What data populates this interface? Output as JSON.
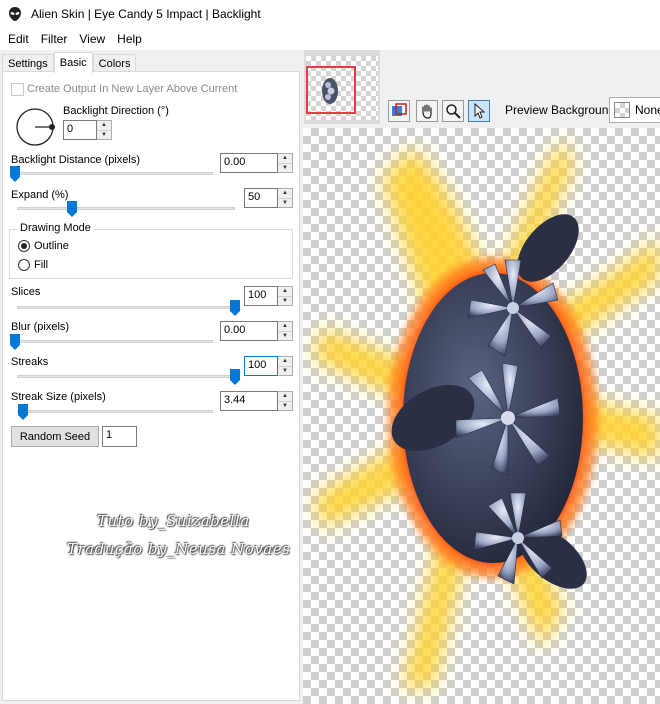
{
  "window": {
    "title": "Alien Skin | Eye Candy 5 Impact | Backlight"
  },
  "menu": [
    "Edit",
    "Filter",
    "View",
    "Help"
  ],
  "tabs": [
    {
      "label": "Settings",
      "active": false
    },
    {
      "label": "Basic",
      "active": true
    },
    {
      "label": "Colors",
      "active": false
    }
  ],
  "settings": {
    "create_output_label": "Create Output In New Layer Above Current",
    "create_output_checked": false,
    "direction_label": "Backlight Direction (°)",
    "direction_value": "0",
    "distance_label": "Backlight Distance (pixels)",
    "distance_value": "0.00",
    "distance_level": 0.0,
    "expand_label": "Expand (%)",
    "expand_value": "50",
    "expand_level": 0.25,
    "drawing_mode_label": "Drawing Mode",
    "mode_outline": "Outline",
    "mode_fill": "Fill",
    "selected_mode": "Outline",
    "slices_label": "Slices",
    "slices_value": "100",
    "slices_level": 1.0,
    "blur_label": "Blur (pixels)",
    "blur_value": "0.00",
    "blur_level": 0.0,
    "streaks_label": "Streaks",
    "streaks_value": "100",
    "streaks_level": 1.0,
    "streak_size_label": "Streak Size (pixels)",
    "streak_size_value": "3.44",
    "streak_size_level": 0.03,
    "random_seed_button": "Random Seed",
    "random_seed_value": "1"
  },
  "preview": {
    "background_label": "Preview Background:",
    "background_value": "None"
  },
  "watermark": {
    "line1": "Tuto by_Suizabella",
    "line2": "Tradução by_Neusa Novaes"
  },
  "colors": {
    "accent": "#0078d7",
    "thumb_border": "#e04040"
  }
}
